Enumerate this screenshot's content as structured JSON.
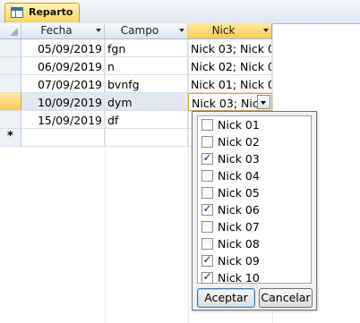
{
  "tab": {
    "label": "Reparto"
  },
  "columns": {
    "fecha": "Fecha",
    "campo": "Campo",
    "nick": "Nick"
  },
  "rows": [
    {
      "fecha": "05/09/2019",
      "campo": "fgn",
      "nick": "Nick 03; Nick 0"
    },
    {
      "fecha": "06/09/2019",
      "campo": "n",
      "nick": "Nick 02; Nick 0"
    },
    {
      "fecha": "07/09/2019",
      "campo": "bvnfg",
      "nick": "Nick 01; Nick 0"
    },
    {
      "fecha": "10/09/2019",
      "campo": "dym",
      "nick": "Nick 03; Nic"
    },
    {
      "fecha": "15/09/2019",
      "campo": "df",
      "nick": ""
    }
  ],
  "new_row_marker": "*",
  "dropdown": {
    "options": [
      {
        "label": "Nick 01",
        "checked": false,
        "mark": ""
      },
      {
        "label": "Nick 02",
        "checked": false,
        "mark": ""
      },
      {
        "label": "Nick 03",
        "checked": true,
        "mark": "✓"
      },
      {
        "label": "Nick 04",
        "checked": false,
        "mark": ""
      },
      {
        "label": "Nick 05",
        "checked": false,
        "mark": ""
      },
      {
        "label": "Nick 06",
        "checked": true,
        "mark": "✓"
      },
      {
        "label": "Nick 07",
        "checked": false,
        "mark": ""
      },
      {
        "label": "Nick 08",
        "checked": false,
        "mark": ""
      },
      {
        "label": "Nick 09",
        "checked": true,
        "mark": "✓"
      },
      {
        "label": "Nick 10",
        "checked": true,
        "mark": "✓"
      }
    ],
    "ok_label": "Aceptar",
    "cancel_label": "Cancelar"
  }
}
